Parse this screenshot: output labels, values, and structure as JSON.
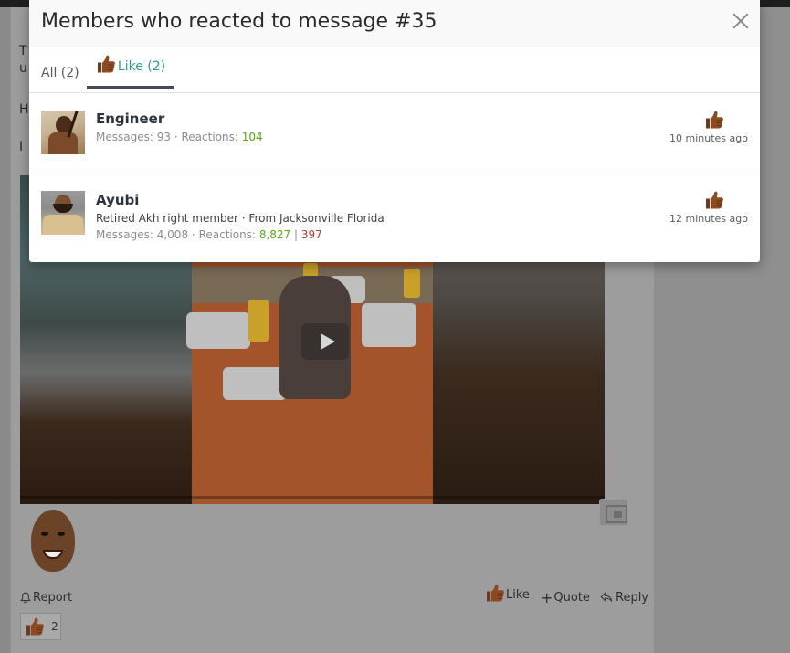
{
  "background": {
    "text_fragments": [
      "T",
      "u",
      "H",
      "I"
    ],
    "actions": {
      "report": "Report",
      "like": "Like",
      "quote": "Quote",
      "reply": "Reply"
    },
    "reaction_count": "2"
  },
  "modal": {
    "title": "Members who reacted to message #35",
    "tabs": [
      {
        "label": "All (2)",
        "active": false
      },
      {
        "label": "Like (2)",
        "active": true,
        "icon": "thumbs-up-icon"
      }
    ],
    "members": [
      {
        "name": "Engineer",
        "title_line": "",
        "messages_label": "Messages:",
        "messages": "93",
        "reactions_label": "Reactions:",
        "reactions_positive": "104",
        "reactions_negative": "",
        "reaction_icon": "thumbs-up-icon",
        "time": "10 minutes ago"
      },
      {
        "name": "Ayubi",
        "title_line": "Retired Akh right member · From Jacksonville Florida",
        "messages_label": "Messages:",
        "messages": "4,008",
        "reactions_label": "Reactions:",
        "reactions_positive": "8,827",
        "reactions_negative": "397",
        "reaction_icon": "thumbs-up-icon",
        "time": "12 minutes ago"
      }
    ]
  },
  "colors": {
    "accent_teal": "#2a9b95",
    "positive": "#5aa51a",
    "negative": "#c0392b"
  }
}
